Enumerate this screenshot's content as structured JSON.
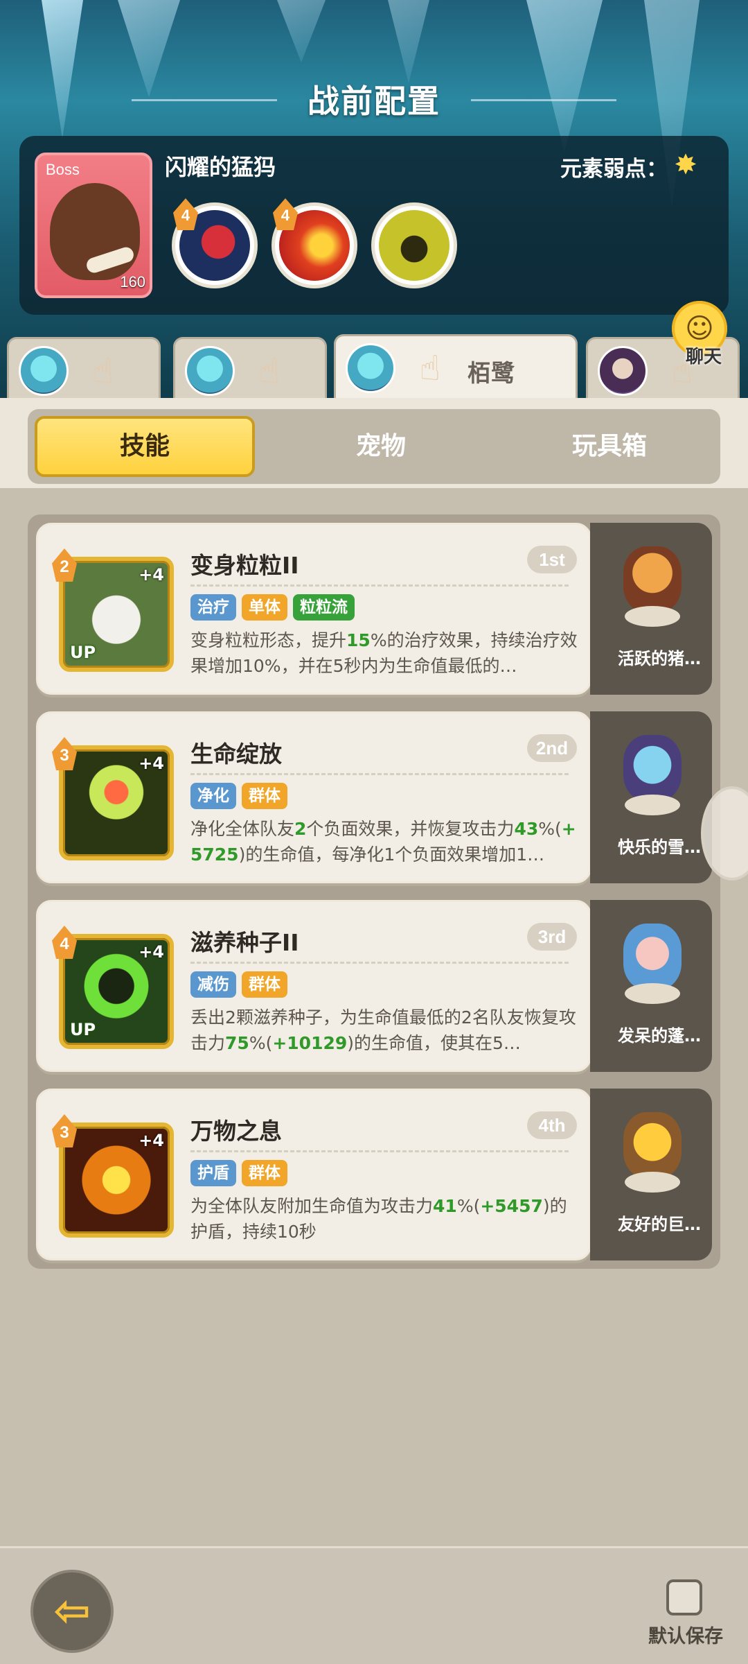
{
  "header": {
    "title": "战前配置"
  },
  "boss": {
    "tag": "Boss",
    "name": "闪耀的猛犸",
    "level": "160",
    "weakness_label": "元素弱点：",
    "weakness_icon": "star-icon",
    "skills": [
      {
        "level": "4",
        "icon": "red-fist-icon"
      },
      {
        "level": "4",
        "icon": "fire-swirl-icon"
      },
      {
        "level": "",
        "icon": "yellow-creature-icon"
      }
    ]
  },
  "heroes": [
    {
      "name": "",
      "active": false
    },
    {
      "name": "",
      "active": false
    },
    {
      "name": "栢鹭",
      "active": true
    },
    {
      "name": "",
      "active": false
    }
  ],
  "chat": {
    "label": "聊天"
  },
  "tabs": [
    {
      "label": "技能",
      "active": true
    },
    {
      "label": "宠物",
      "active": false
    },
    {
      "label": "玩具箱",
      "active": false
    }
  ],
  "skills": [
    {
      "cost": "2",
      "plus": "+4",
      "up": "UP",
      "name": "变身粒粒II",
      "rank": "1st",
      "tags": [
        {
          "label": "治疗",
          "color": "#5a97cf"
        },
        {
          "label": "单体",
          "color": "#f1a62a"
        },
        {
          "label": "粒粒流",
          "color": "#38a23a"
        }
      ],
      "desc_parts": [
        "变身粒粒形态，提升",
        "15",
        "%的治疗效果，持续治疗效果增加10%，并在5秒内为生命值最低的…"
      ],
      "pet": "活跃的猪…"
    },
    {
      "cost": "3",
      "plus": "+4",
      "up": "",
      "name": "生命绽放",
      "rank": "2nd",
      "tags": [
        {
          "label": "净化",
          "color": "#5a97cf"
        },
        {
          "label": "群体",
          "color": "#f1a62a"
        }
      ],
      "desc_parts": [
        "净化全体队友",
        "2",
        "个负面效果，并恢复攻击力",
        "43",
        "%(",
        "+5725",
        ")的生命值，每净化1个负面效果增加1…"
      ],
      "pet": "快乐的雪…"
    },
    {
      "cost": "4",
      "plus": "+4",
      "up": "UP",
      "name": "滋养种子II",
      "rank": "3rd",
      "tags": [
        {
          "label": "减伤",
          "color": "#5a97cf"
        },
        {
          "label": "群体",
          "color": "#f1a62a"
        }
      ],
      "desc_parts": [
        "丢出2颗滋养种子，为生命值最低的2名队友恢复攻击力",
        "75",
        "%(",
        "+10129",
        ")的生命值，使其在5…"
      ],
      "pet": "发呆的蓬…"
    },
    {
      "cost": "3",
      "plus": "+4",
      "up": "",
      "name": "万物之息",
      "rank": "4th",
      "tags": [
        {
          "label": "护盾",
          "color": "#5a97cf"
        },
        {
          "label": "群体",
          "color": "#f1a62a"
        }
      ],
      "desc_parts": [
        "为全体队友附加生命值为攻击力",
        "41",
        "%(",
        "+5457",
        ")的护盾，持续10秒"
      ],
      "pet": "友好的巨…"
    }
  ],
  "footer": {
    "back_icon": "back-arrow-icon",
    "default_save_label": "默认保存"
  }
}
